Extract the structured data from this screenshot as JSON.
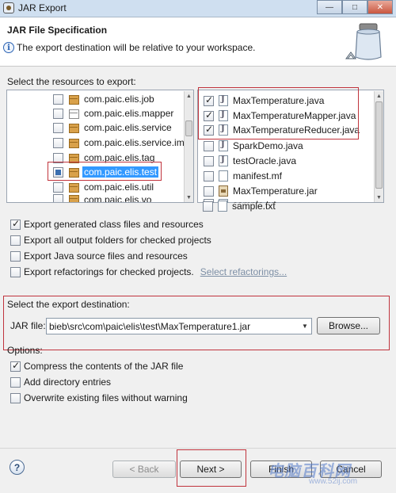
{
  "window": {
    "title": "JAR Export"
  },
  "header": {
    "title": "JAR File Specification",
    "message": "The export destination will be relative to your workspace."
  },
  "resources": {
    "label": "Select the resources to export:",
    "tree": [
      {
        "label": "com.paic.elis.job",
        "checked": false,
        "icon": "package-icon"
      },
      {
        "label": "com.paic.elis.mapper",
        "checked": false,
        "icon": "package-empty-icon"
      },
      {
        "label": "com.paic.elis.service",
        "checked": false,
        "icon": "package-icon"
      },
      {
        "label": "com.paic.elis.service.imp",
        "checked": false,
        "icon": "package-icon"
      },
      {
        "label": "com.paic.elis.tag",
        "checked": false,
        "icon": "package-icon"
      },
      {
        "label": "com.paic.elis.test",
        "checked": "partial",
        "icon": "package-icon",
        "selected": true
      },
      {
        "label": "com.paic.elis.util",
        "checked": false,
        "icon": "package-icon"
      },
      {
        "label": "com.paic.elis.vo",
        "checked": false,
        "icon": "package-icon"
      }
    ],
    "files": [
      {
        "label": "MaxTemperature.java",
        "checked": true,
        "icon": "java-file-icon"
      },
      {
        "label": "MaxTemperatureMapper.java",
        "checked": true,
        "icon": "java-file-icon"
      },
      {
        "label": "MaxTemperatureReducer.java",
        "checked": true,
        "icon": "java-file-icon"
      },
      {
        "label": "SparkDemo.java",
        "checked": false,
        "icon": "java-file-icon"
      },
      {
        "label": "testOracle.java",
        "checked": false,
        "icon": "java-file-icon"
      },
      {
        "label": "manifest.mf",
        "checked": false,
        "icon": "file-icon"
      },
      {
        "label": "MaxTemperature.jar",
        "checked": false,
        "icon": "jar-file-icon"
      },
      {
        "label": "sample.txt",
        "checked": false,
        "icon": "file-icon"
      }
    ]
  },
  "export_options": [
    {
      "label": "Export generated class files and resources",
      "checked": true
    },
    {
      "label": "Export all output folders for checked projects",
      "checked": false
    },
    {
      "label": "Export Java source files and resources",
      "checked": false
    },
    {
      "label": "Export refactorings for checked projects.",
      "checked": false
    }
  ],
  "select_refactorings_link": "Select refactorings...",
  "destination": {
    "label": "Select the export destination:",
    "jar_file_label": "JAR file:",
    "jar_file_value": "bieb\\src\\com\\paic\\elis\\test\\MaxTemperature1.jar",
    "browse_label": "Browse..."
  },
  "options": {
    "label": "Options:",
    "items": [
      {
        "label": "Compress the contents of the JAR file",
        "checked": true
      },
      {
        "label": "Add directory entries",
        "checked": false
      },
      {
        "label": "Overwrite existing files without warning",
        "checked": false
      }
    ]
  },
  "buttons": {
    "help": "?",
    "back": "< Back",
    "next": "Next >",
    "finish": "Finish",
    "cancel": "Cancel"
  },
  "watermark": {
    "main": "电脑百科网",
    "sub": "www.52ij.com"
  },
  "colors": {
    "annotation": "#c0343d",
    "selection": "#3399ff",
    "link": "#7d8fa5"
  }
}
